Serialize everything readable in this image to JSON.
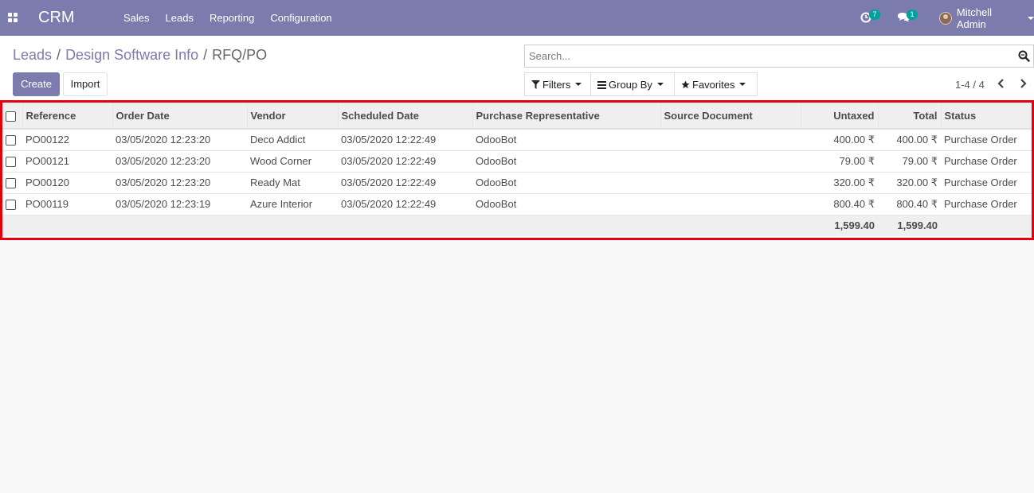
{
  "navbar": {
    "brand": "CRM",
    "menu": [
      "Sales",
      "Leads",
      "Reporting",
      "Configuration"
    ],
    "activity_count": "7",
    "messages_count": "1",
    "user_name": "Mitchell Admin",
    "color": "#7c7bad"
  },
  "breadcrumb": [
    "Leads",
    "Design Software Info",
    "RFQ/PO"
  ],
  "buttons": {
    "create": "Create",
    "import": "Import"
  },
  "search": {
    "placeholder": "Search..."
  },
  "filters": {
    "filters": "Filters",
    "group_by": "Group By",
    "favorites": "Favorites"
  },
  "pager": {
    "value": "1-4 / 4"
  },
  "table": {
    "columns": [
      "Reference",
      "Order Date",
      "Vendor",
      "Scheduled Date",
      "Purchase Representative",
      "Source Document",
      "Untaxed",
      "Total",
      "Status"
    ],
    "rows": [
      [
        "PO00122",
        "03/05/2020 12:23:20",
        "Deco Addict",
        "03/05/2020 12:22:49",
        "OdooBot",
        "",
        "400.00 ₹",
        "400.00 ₹",
        "Purchase Order"
      ],
      [
        "PO00121",
        "03/05/2020 12:23:20",
        "Wood Corner",
        "03/05/2020 12:22:49",
        "OdooBot",
        "",
        "79.00 ₹",
        "79.00 ₹",
        "Purchase Order"
      ],
      [
        "PO00120",
        "03/05/2020 12:23:20",
        "Ready Mat",
        "03/05/2020 12:22:49",
        "OdooBot",
        "",
        "320.00 ₹",
        "320.00 ₹",
        "Purchase Order"
      ],
      [
        "PO00119",
        "03/05/2020 12:23:19",
        "Azure Interior",
        "03/05/2020 12:22:49",
        "OdooBot",
        "",
        "800.40 ₹",
        "800.40 ₹",
        "Purchase Order"
      ]
    ],
    "totals": {
      "untaxed": "1,599.40",
      "total": "1,599.40"
    }
  },
  "highlight_color": "#e6000e"
}
